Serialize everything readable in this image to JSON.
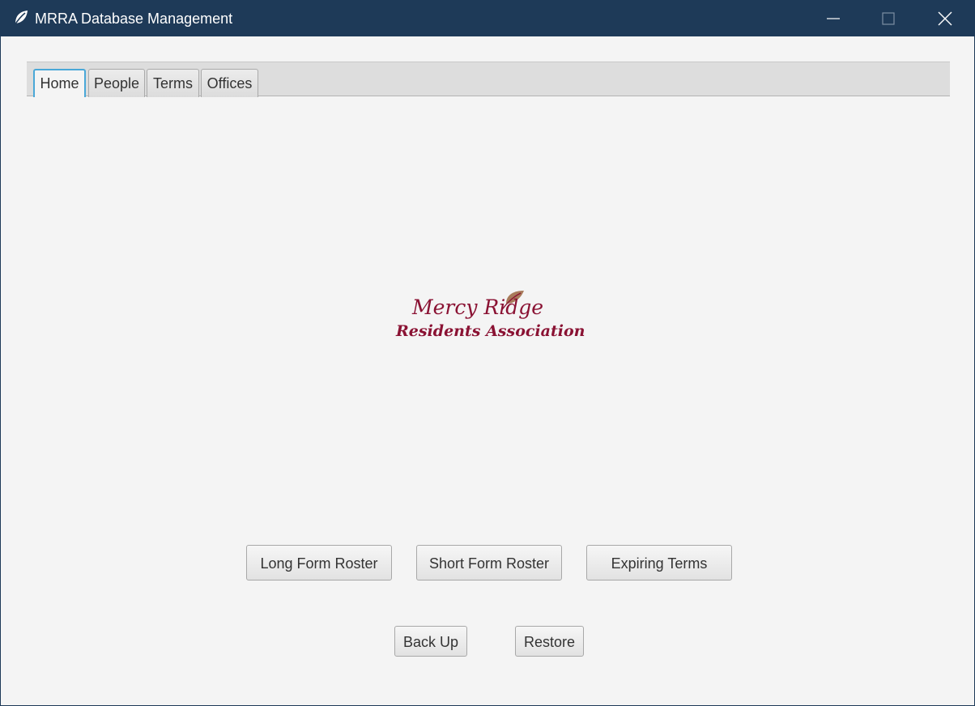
{
  "window": {
    "title": "MRRA Database Management",
    "app_icon": "leaf-icon",
    "controls": {
      "minimize_icon": "minimize-icon",
      "maximize_icon": "maximize-icon",
      "close_icon": "close-icon"
    },
    "colors": {
      "titlebar": "#1e3a58",
      "background": "#f4f4f4"
    }
  },
  "tabs": [
    {
      "label": "Home",
      "active": true
    },
    {
      "label": "People",
      "active": false
    },
    {
      "label": "Terms",
      "active": false
    },
    {
      "label": "Offices",
      "active": false
    }
  ],
  "logo": {
    "line1": "Mercy Ridge",
    "line2": "Residents Association",
    "color": "#8a1233",
    "leaf_color": "#a87a5a"
  },
  "buttons": {
    "long_form_roster": "Long Form Roster",
    "short_form_roster": "Short Form Roster",
    "expiring_terms": "Expiring Terms",
    "back_up": "Back Up",
    "restore": "Restore"
  }
}
